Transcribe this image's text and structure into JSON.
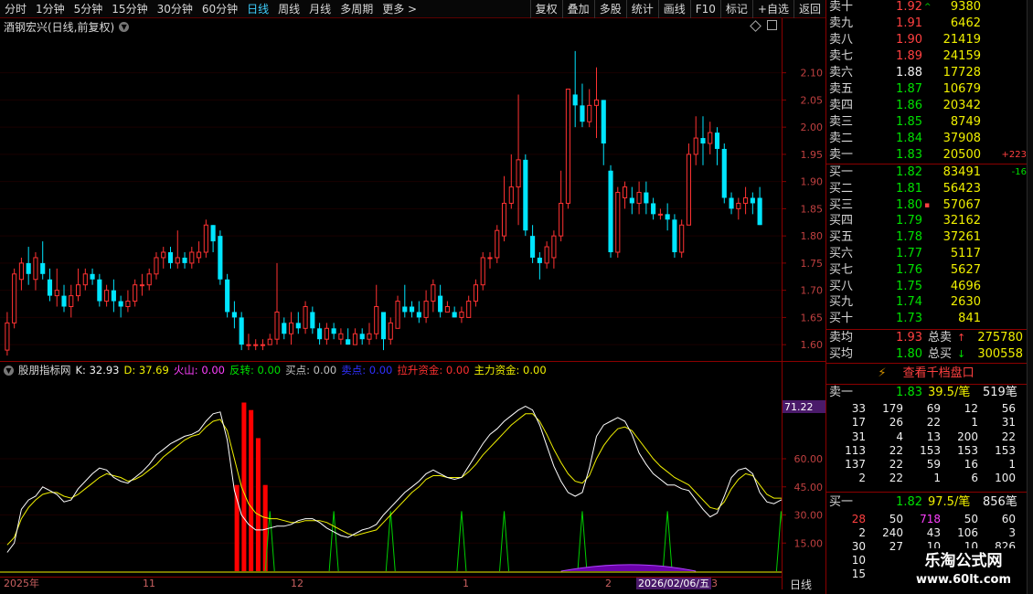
{
  "toolbar": {
    "periods": [
      "分时",
      "1分钟",
      "5分钟",
      "15分钟",
      "30分钟",
      "60分钟",
      "日线",
      "周线",
      "月线",
      "多周期",
      "更多 >"
    ],
    "active_period": "日线",
    "tools": [
      "复权",
      "叠加",
      "多股",
      "统计",
      "画线",
      "F10",
      "标记",
      "+自选",
      "返回"
    ]
  },
  "title": "酒钢宏兴(日线,前复权)",
  "price_axis": [
    "2.10",
    "2.05",
    "2.00",
    "1.95",
    "1.90",
    "1.85",
    "1.80",
    "1.75",
    "1.70",
    "1.65",
    "1.60"
  ],
  "indicator": {
    "name": "股朋指标网",
    "k_label": "K: 32.93",
    "d_label": "D: 37.69",
    "huoshan": "火山: 0.00",
    "fanzhuan": "反转: 0.00",
    "maidian": "买点: 0.00",
    "maidian2": "卖点: 0.00",
    "lasheng": "拉升资金: 0.00",
    "zhuli": "主力资金: 0.00",
    "axis": [
      "60.00",
      "45.00",
      "30.00",
      "15.00"
    ],
    "current_value": "71.22"
  },
  "dates": {
    "labels": [
      "2025年",
      "11",
      "12",
      "1",
      "2",
      "3"
    ],
    "cursor": "2026/02/06/五",
    "period": "日线"
  },
  "colors": {
    "up": "#ff3232",
    "down": "#00e5ff",
    "k_line": "#ffffff",
    "d_line": "#f0f000",
    "fanzhuan": "#00d000",
    "huoshan": "#ff0000",
    "accent_bg": "#8b0000"
  },
  "orderbook": {
    "asks": [
      {
        "label": "卖十",
        "price": "1.92",
        "vol": "9380",
        "flag": "^"
      },
      {
        "label": "卖九",
        "price": "1.91",
        "vol": "6462"
      },
      {
        "label": "卖八",
        "price": "1.90",
        "vol": "21419"
      },
      {
        "label": "卖七",
        "price": "1.89",
        "vol": "24159"
      },
      {
        "label": "卖六",
        "price": "1.88",
        "vol": "17728"
      },
      {
        "label": "卖五",
        "price": "1.87",
        "vol": "10679"
      },
      {
        "label": "卖四",
        "price": "1.86",
        "vol": "20342"
      },
      {
        "label": "卖三",
        "price": "1.85",
        "vol": "8749"
      },
      {
        "label": "卖二",
        "price": "1.84",
        "vol": "37908"
      },
      {
        "label": "卖一",
        "price": "1.83",
        "vol": "20500",
        "chg": "+223"
      }
    ],
    "bids": [
      {
        "label": "买一",
        "price": "1.82",
        "vol": "83491",
        "chg": "-16"
      },
      {
        "label": "买二",
        "price": "1.81",
        "vol": "56423"
      },
      {
        "label": "买三",
        "price": "1.80",
        "vol": "57067",
        "flag": "▪"
      },
      {
        "label": "买四",
        "price": "1.79",
        "vol": "32162"
      },
      {
        "label": "买五",
        "price": "1.78",
        "vol": "37261"
      },
      {
        "label": "买六",
        "price": "1.77",
        "vol": "5117"
      },
      {
        "label": "买七",
        "price": "1.76",
        "vol": "5627"
      },
      {
        "label": "买八",
        "price": "1.75",
        "vol": "4696"
      },
      {
        "label": "买九",
        "price": "1.74",
        "vol": "2630"
      },
      {
        "label": "买十",
        "price": "1.73",
        "vol": "841"
      }
    ],
    "avg_ask": {
      "label": "卖均",
      "price": "1.93",
      "total_label": "总卖",
      "total": "275780"
    },
    "avg_bid": {
      "label": "买均",
      "price": "1.80",
      "total_label": "总买",
      "total": "300558"
    }
  },
  "qiandang": {
    "button": "查看千档盘口",
    "sell1": {
      "label": "卖一",
      "price": "1.83",
      "per": "39.5/笔",
      "count": "519笔"
    },
    "sell_grid": [
      [
        "33",
        "179",
        "69",
        "12",
        "56"
      ],
      [
        "17",
        "26",
        "22",
        "1",
        "31"
      ],
      [
        "31",
        "4",
        "13",
        "200",
        "22"
      ],
      [
        "113",
        "22",
        "153",
        "153",
        "153"
      ],
      [
        "137",
        "22",
        "59",
        "16",
        "1"
      ],
      [
        "2",
        "22",
        "1",
        "6",
        "100"
      ]
    ],
    "buy1": {
      "label": "买一",
      "price": "1.82",
      "per": "97.5/笔",
      "count": "856笔"
    },
    "buy_grid": [
      [
        "28",
        "50",
        "718",
        "50",
        "60"
      ],
      [
        "2",
        "240",
        "43",
        "106",
        "3"
      ],
      [
        "30",
        "27",
        "10",
        "10",
        "826"
      ],
      [
        "10",
        "",
        "",
        "",
        ""
      ],
      [
        "15",
        "",
        "",
        "",
        ""
      ]
    ]
  },
  "watermark": {
    "line1": "乐淘公式网",
    "line2": "www.60lt.com"
  },
  "chart_data": {
    "type": "candlestick",
    "ylim": [
      1.57,
      2.17
    ],
    "indicator_ylim": [
      0,
      100
    ],
    "candles": [
      [
        1.59,
        1.64,
        1.66,
        1.58
      ],
      [
        1.64,
        1.73,
        1.74,
        1.63
      ],
      [
        1.72,
        1.75,
        1.76,
        1.7
      ],
      [
        1.75,
        1.73,
        1.78,
        1.71
      ],
      [
        1.72,
        1.76,
        1.77,
        1.7
      ],
      [
        1.75,
        1.73,
        1.79,
        1.72
      ],
      [
        1.72,
        1.69,
        1.74,
        1.68
      ],
      [
        1.69,
        1.7,
        1.74,
        1.67
      ],
      [
        1.69,
        1.67,
        1.71,
        1.66
      ],
      [
        1.67,
        1.69,
        1.71,
        1.65
      ],
      [
        1.69,
        1.71,
        1.74,
        1.68
      ],
      [
        1.71,
        1.73,
        1.74,
        1.7
      ],
      [
        1.73,
        1.72,
        1.74,
        1.71
      ],
      [
        1.72,
        1.68,
        1.73,
        1.67
      ],
      [
        1.68,
        1.7,
        1.71,
        1.67
      ],
      [
        1.7,
        1.68,
        1.72,
        1.66
      ],
      [
        1.68,
        1.67,
        1.69,
        1.65
      ],
      [
        1.67,
        1.68,
        1.7,
        1.66
      ],
      [
        1.68,
        1.71,
        1.72,
        1.67
      ],
      [
        1.71,
        1.71,
        1.73,
        1.69
      ],
      [
        1.71,
        1.73,
        1.74,
        1.7
      ],
      [
        1.73,
        1.76,
        1.77,
        1.72
      ],
      [
        1.76,
        1.77,
        1.78,
        1.74
      ],
      [
        1.77,
        1.75,
        1.78,
        1.74
      ],
      [
        1.75,
        1.76,
        1.81,
        1.74
      ],
      [
        1.76,
        1.75,
        1.77,
        1.74
      ],
      [
        1.75,
        1.77,
        1.78,
        1.74
      ],
      [
        1.76,
        1.77,
        1.79,
        1.75
      ],
      [
        1.77,
        1.82,
        1.83,
        1.76
      ],
      [
        1.82,
        1.79,
        1.82,
        1.77
      ],
      [
        1.8,
        1.72,
        1.81,
        1.71
      ],
      [
        1.72,
        1.66,
        1.73,
        1.65
      ],
      [
        1.66,
        1.65,
        1.68,
        1.63
      ],
      [
        1.65,
        1.6,
        1.66,
        1.59
      ],
      [
        1.6,
        1.6,
        1.62,
        1.59
      ],
      [
        1.6,
        1.6,
        1.61,
        1.59
      ],
      [
        1.6,
        1.6,
        1.61,
        1.59
      ],
      [
        1.6,
        1.61,
        1.62,
        1.6
      ],
      [
        1.61,
        1.66,
        1.75,
        1.6
      ],
      [
        1.64,
        1.62,
        1.65,
        1.61
      ],
      [
        1.62,
        1.64,
        1.66,
        1.6
      ],
      [
        1.64,
        1.63,
        1.66,
        1.62
      ],
      [
        1.63,
        1.67,
        1.68,
        1.62
      ],
      [
        1.66,
        1.63,
        1.67,
        1.62
      ],
      [
        1.63,
        1.61,
        1.64,
        1.6
      ],
      [
        1.61,
        1.63,
        1.64,
        1.6
      ],
      [
        1.63,
        1.62,
        1.64,
        1.61
      ],
      [
        1.61,
        1.62,
        1.63,
        1.6
      ],
      [
        1.61,
        1.6,
        1.63,
        1.6
      ],
      [
        1.6,
        1.62,
        1.63,
        1.6
      ],
      [
        1.62,
        1.61,
        1.63,
        1.6
      ],
      [
        1.61,
        1.62,
        1.64,
        1.6
      ],
      [
        1.62,
        1.67,
        1.71,
        1.61
      ],
      [
        1.66,
        1.61,
        1.66,
        1.59
      ],
      [
        1.61,
        1.64,
        1.65,
        1.6
      ],
      [
        1.63,
        1.68,
        1.69,
        1.63
      ],
      [
        1.67,
        1.66,
        1.71,
        1.65
      ],
      [
        1.67,
        1.66,
        1.68,
        1.65
      ],
      [
        1.66,
        1.65,
        1.68,
        1.64
      ],
      [
        1.65,
        1.68,
        1.7,
        1.64
      ],
      [
        1.68,
        1.71,
        1.72,
        1.66
      ],
      [
        1.69,
        1.66,
        1.71,
        1.65
      ],
      [
        1.66,
        1.67,
        1.68,
        1.66
      ],
      [
        1.66,
        1.65,
        1.67,
        1.65
      ],
      [
        1.65,
        1.66,
        1.67,
        1.64
      ],
      [
        1.65,
        1.68,
        1.69,
        1.65
      ],
      [
        1.68,
        1.71,
        1.72,
        1.67
      ],
      [
        1.71,
        1.76,
        1.77,
        1.7
      ],
      [
        1.76,
        1.76,
        1.77,
        1.74
      ],
      [
        1.76,
        1.81,
        1.82,
        1.75
      ],
      [
        1.8,
        1.86,
        1.91,
        1.79
      ],
      [
        1.86,
        1.89,
        1.95,
        1.85
      ],
      [
        1.89,
        1.94,
        2.06,
        1.82
      ],
      [
        1.94,
        1.81,
        1.95,
        1.8
      ],
      [
        1.8,
        1.76,
        1.82,
        1.75
      ],
      [
        1.76,
        1.75,
        1.77,
        1.72
      ],
      [
        1.75,
        1.78,
        1.79,
        1.74
      ],
      [
        1.76,
        1.8,
        1.81,
        1.74
      ],
      [
        1.8,
        1.86,
        1.92,
        1.79
      ],
      [
        1.86,
        2.07,
        2.07,
        1.85
      ],
      [
        2.06,
        2.04,
        2.14,
        2.0
      ],
      [
        2.04,
        2.01,
        2.08,
        2.0
      ],
      [
        2.01,
        2.04,
        2.07,
        2.0
      ],
      [
        2.04,
        2.05,
        2.11,
        1.98
      ],
      [
        2.05,
        1.97,
        2.05,
        1.93
      ],
      [
        1.92,
        1.77,
        1.93,
        1.76
      ],
      [
        1.77,
        1.88,
        1.89,
        1.76
      ],
      [
        1.87,
        1.89,
        1.9,
        1.85
      ],
      [
        1.87,
        1.86,
        1.89,
        1.84
      ],
      [
        1.86,
        1.88,
        1.9,
        1.84
      ],
      [
        1.88,
        1.86,
        1.9,
        1.84
      ],
      [
        1.86,
        1.84,
        1.87,
        1.83
      ],
      [
        1.84,
        1.84,
        1.85,
        1.83
      ],
      [
        1.84,
        1.83,
        1.86,
        1.81
      ],
      [
        1.83,
        1.77,
        1.84,
        1.76
      ],
      [
        1.77,
        1.82,
        1.83,
        1.76
      ],
      [
        1.82,
        1.95,
        1.97,
        1.82
      ],
      [
        1.95,
        1.98,
        2.02,
        1.93
      ],
      [
        1.98,
        1.97,
        2.02,
        1.93
      ],
      [
        1.97,
        1.99,
        2.01,
        1.95
      ],
      [
        1.99,
        1.96,
        2.0,
        1.93
      ],
      [
        1.96,
        1.87,
        1.97,
        1.86
      ],
      [
        1.87,
        1.85,
        1.88,
        1.84
      ],
      [
        1.85,
        1.86,
        1.87,
        1.83
      ],
      [
        1.86,
        1.87,
        1.89,
        1.84
      ],
      [
        1.87,
        1.86,
        1.88,
        1.84
      ],
      [
        1.87,
        1.82,
        1.89,
        1.82
      ]
    ],
    "k": [
      10,
      15,
      33,
      38,
      40,
      45,
      43,
      41,
      37,
      38,
      44,
      48,
      52,
      55,
      54,
      50,
      48,
      47,
      50,
      53,
      57,
      62,
      65,
      68,
      70,
      72,
      73,
      75,
      80,
      84,
      85,
      70,
      43,
      30,
      25,
      22,
      22,
      23,
      24,
      24,
      25,
      27,
      28,
      28,
      26,
      23,
      21,
      19,
      18,
      20,
      22,
      23,
      25,
      30,
      34,
      38,
      42,
      45,
      48,
      52,
      54,
      52,
      50,
      49,
      50,
      56,
      62,
      68,
      73,
      76,
      80,
      83,
      86,
      88,
      86,
      78,
      67,
      56,
      48,
      42,
      40,
      42,
      55,
      72,
      78,
      80,
      82,
      80,
      73,
      63,
      57,
      52,
      49,
      46,
      46,
      44,
      43,
      38,
      33,
      29,
      31,
      40,
      50,
      54,
      55,
      52,
      42,
      37,
      36,
      38,
      38,
      32
    ],
    "d": [
      14,
      18,
      28,
      34,
      38,
      41,
      42,
      42,
      40,
      39,
      41,
      44,
      47,
      50,
      52,
      51,
      50,
      48,
      49,
      51,
      54,
      57,
      61,
      64,
      67,
      70,
      72,
      73,
      77,
      80,
      81,
      75,
      60,
      45,
      36,
      31,
      29,
      28,
      28,
      27,
      26,
      26,
      27,
      27,
      27,
      26,
      24,
      22,
      20,
      19,
      20,
      21,
      22,
      26,
      30,
      34,
      38,
      42,
      45,
      49,
      51,
      51,
      50,
      50,
      50,
      53,
      57,
      62,
      66,
      70,
      74,
      78,
      81,
      84,
      84,
      80,
      73,
      65,
      58,
      52,
      48,
      47,
      51,
      60,
      67,
      72,
      76,
      77,
      75,
      70,
      65,
      60,
      56,
      53,
      50,
      48,
      46,
      42,
      38,
      34,
      33,
      37,
      44,
      49,
      52,
      51,
      46,
      41,
      39,
      39,
      38,
      35
    ],
    "fanzhuan": [
      37,
      46,
      54,
      64,
      70,
      81,
      93,
      109
    ],
    "huoshan": [
      33,
      34,
      35,
      36
    ],
    "huoshan_values": [
      46,
      90,
      86,
      71,
      46
    ]
  }
}
